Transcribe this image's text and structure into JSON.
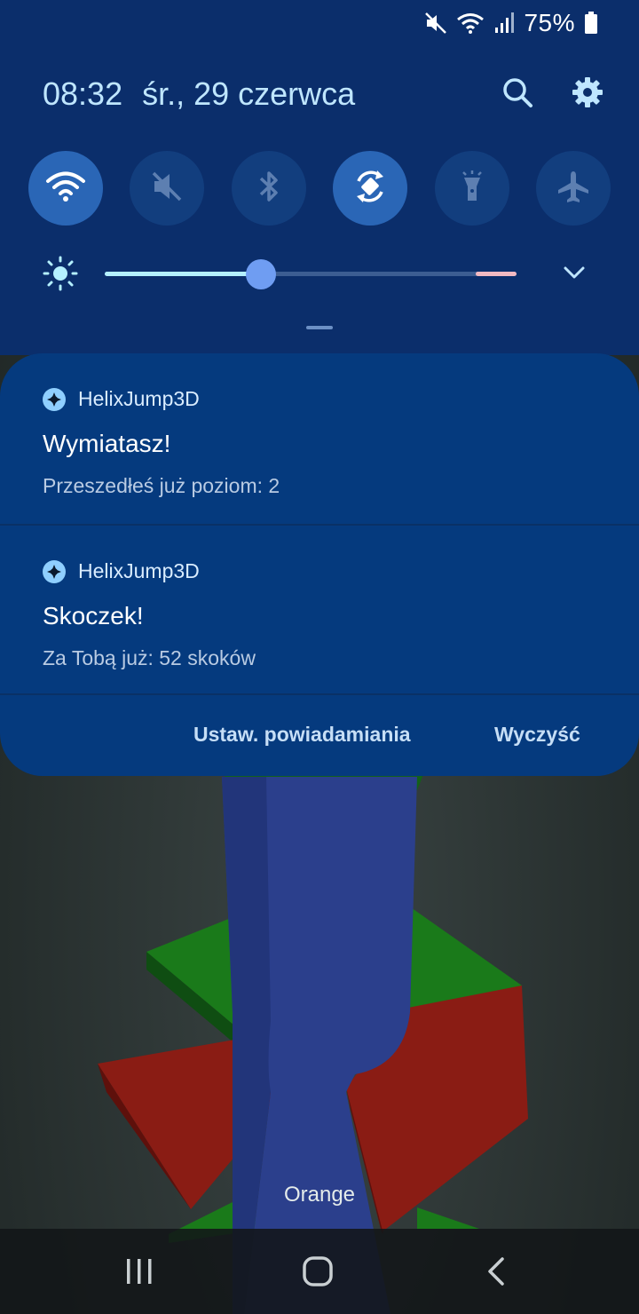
{
  "status_bar": {
    "icons": [
      "mute-icon",
      "wifi-icon",
      "signal-icon",
      "battery-icon"
    ],
    "battery": "75%"
  },
  "header": {
    "time": "08:32",
    "date": "śr., 29 czerwca",
    "icons": [
      "search-icon",
      "settings-gear-icon"
    ]
  },
  "quick_settings": [
    {
      "name": "wifi",
      "icon": "wifi-icon",
      "on": true
    },
    {
      "name": "sound",
      "icon": "mute-icon",
      "on": false
    },
    {
      "name": "bluetooth",
      "icon": "bluetooth-icon",
      "on": false
    },
    {
      "name": "auto-rotate",
      "icon": "auto-rotate-icon",
      "on": true
    },
    {
      "name": "flashlight",
      "icon": "flashlight-icon",
      "on": false
    },
    {
      "name": "airplane",
      "icon": "airplane-icon",
      "on": false
    }
  ],
  "brightness": {
    "level": 0.38
  },
  "notifications": [
    {
      "app": "HelixJump3D",
      "title": "Wymiatasz!",
      "text": "Przeszedłeś już poziom: 2"
    },
    {
      "app": "HelixJump3D",
      "title": "Skoczek!",
      "text": "Za Tobą już: 52 skoków"
    }
  ],
  "actions": {
    "settings_label": "Ustaw. powiadamiania",
    "clear_label": "Wyczyść"
  },
  "carrier": "Orange",
  "colors": {
    "shade_bg": "#0b2e6b",
    "card_bg": "#053a7e",
    "accent": "#6f9df2",
    "tower": "#2b3f8c",
    "platform_green": "#1a7a1a",
    "platform_red": "#8a1c14"
  }
}
